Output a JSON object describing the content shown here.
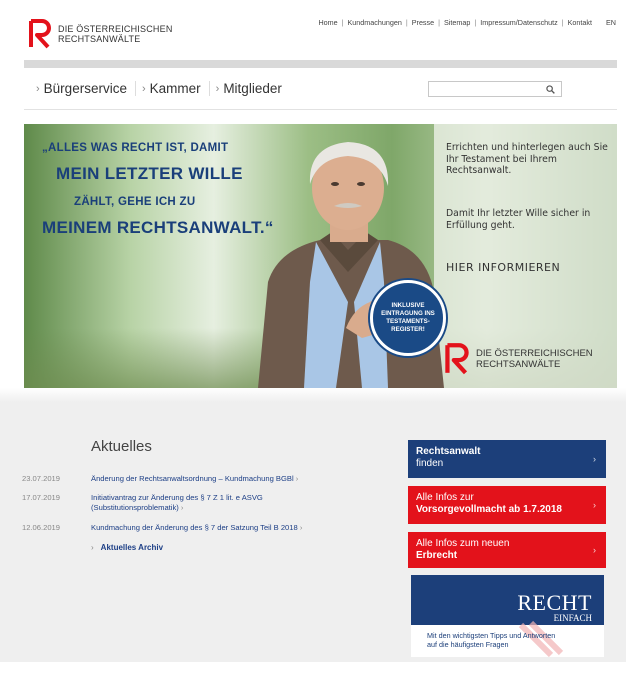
{
  "brand": {
    "line1": "DIE ÖSTERREICHISCHEN",
    "line2": "RECHTSANWÄLTE",
    "red": "#e3121b",
    "blue": "#1c3f7a"
  },
  "topnav": {
    "items": [
      "Home",
      "Kundmachungen",
      "Presse",
      "Sitemap",
      "Impressum/Datenschutz",
      "Kontakt"
    ],
    "lang": "EN"
  },
  "mainnav": {
    "items": [
      "Bürgerservice",
      "Kammer",
      "Mitglieder"
    ],
    "search_placeholder": ""
  },
  "hero": {
    "slogan1": "„ALLES WAS RECHT IST, DAMIT",
    "slogan2": "MEIN LETZTER WILLE",
    "slogan3": "ZÄHLT, GEHE ICH ZU",
    "slogan4": "MEINEM RECHTSANWALT.“",
    "text1": "Errichten und hinterlegen auch Sie Ihr Testament bei Ihrem Rechtsanwalt.",
    "text2": "Damit Ihr letzter Wille sicher in Erfüllung geht.",
    "cta": "HIER INFORMIEREN",
    "badge": "INKLUSIVE EINTRAGUNG INS TESTAMENTS-REGISTER!",
    "logo_line1": "DIE ÖSTERREICHISCHEN",
    "logo_line2": "RECHTSANWÄLTE"
  },
  "aktuelles": {
    "title": "Aktuelles",
    "items": [
      {
        "date": "23.07.2019",
        "title": "Änderung der Rechtsanwaltsordnung – Kundmachung BGBl"
      },
      {
        "date": "17.07.2019",
        "title": "Initiativantrag zur Änderung des § 7 Z 1 lit. e ASVG (Substitutionsproblematik)"
      },
      {
        "date": "12.06.2019",
        "title": "Kundmachung der Änderung des § 7 der Satzung Teil B 2018"
      }
    ],
    "archive": "Aktuelles Archiv"
  },
  "ctas": {
    "blue_line1": "Rechtsanwalt",
    "blue_line2": "finden",
    "red1_line1": "Alle Infos zur",
    "red1_line2": "Vorsorgevollmacht ab 1.7.2018",
    "red2_line1": "Alle Infos zum neuen",
    "red2_line2": "Erbrecht"
  },
  "recht": {
    "title": "RECHT",
    "subtitle": "EINFACH",
    "desc_line1": "Mit den wichtigsten Tipps und Antworten",
    "desc_line2": "auf die häufigsten Fragen"
  }
}
